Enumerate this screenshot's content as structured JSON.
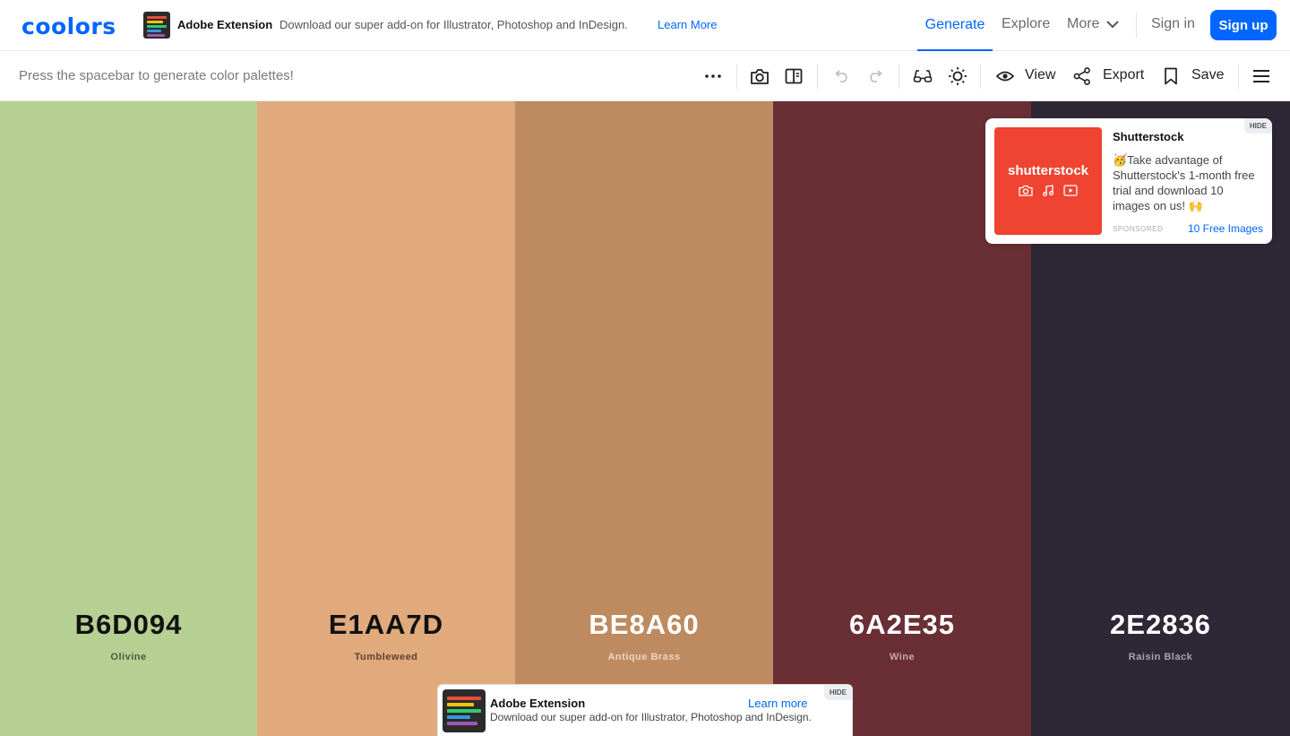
{
  "brand": {
    "logo_text": "coolors",
    "accent_color": "#0066ff"
  },
  "promo": {
    "title": "Adobe Extension",
    "text": "Download our super add-on for Illustrator, Photoshop and InDesign.",
    "link": "Learn More"
  },
  "nav": {
    "generate": "Generate",
    "explore": "Explore",
    "more": "More",
    "sign_in": "Sign in",
    "sign_up": "Sign up"
  },
  "toolbar": {
    "hint": "Press the spacebar to generate color palettes!",
    "view_label": "View",
    "export_label": "Export",
    "save_label": "Save",
    "icons": [
      "more-options-icon",
      "camera-icon",
      "split-view-icon",
      "undo-icon",
      "redo-icon",
      "glasses-icon",
      "brightness-icon",
      "eye-icon",
      "share-icon",
      "bookmark-icon",
      "hamburger-menu-icon"
    ]
  },
  "palette": [
    {
      "hex": "B6D094",
      "name": "Olivine",
      "color": "#B6D094",
      "text_color": "#111111",
      "name_color": "#4a5a3a"
    },
    {
      "hex": "E1AA7D",
      "name": "Tumbleweed",
      "color": "#E1AA7D",
      "text_color": "#111111",
      "name_color": "#5e4330"
    },
    {
      "hex": "BE8A60",
      "name": "Antique Brass",
      "color": "#BE8A60",
      "text_color": "#ffffff",
      "name_color": "#ecd5c2"
    },
    {
      "hex": "6A2E35",
      "name": "Wine",
      "color": "#6A2E35",
      "text_color": "#ffffff",
      "name_color": "#c7a7ab"
    },
    {
      "hex": "2E2836",
      "name": "Raisin Black",
      "color": "#2E2836",
      "text_color": "#ffffff",
      "name_color": "#a8a4ad"
    }
  ],
  "ad": {
    "logo_text": "shutterstock",
    "title": "Shutterstock",
    "body": "🥳Take advantage of Shutterstock's 1-month free trial and download 10 images on us! 🙌",
    "sponsored": "SPONSORED",
    "cta": "10 Free Images",
    "hide": "HIDE",
    "logo_color": "#ee4431"
  },
  "banner": {
    "title": "Adobe Extension",
    "text": "Download our super add-on for Illustrator, Photoshop and InDesign.",
    "link": "Learn more",
    "hide": "HIDE"
  }
}
